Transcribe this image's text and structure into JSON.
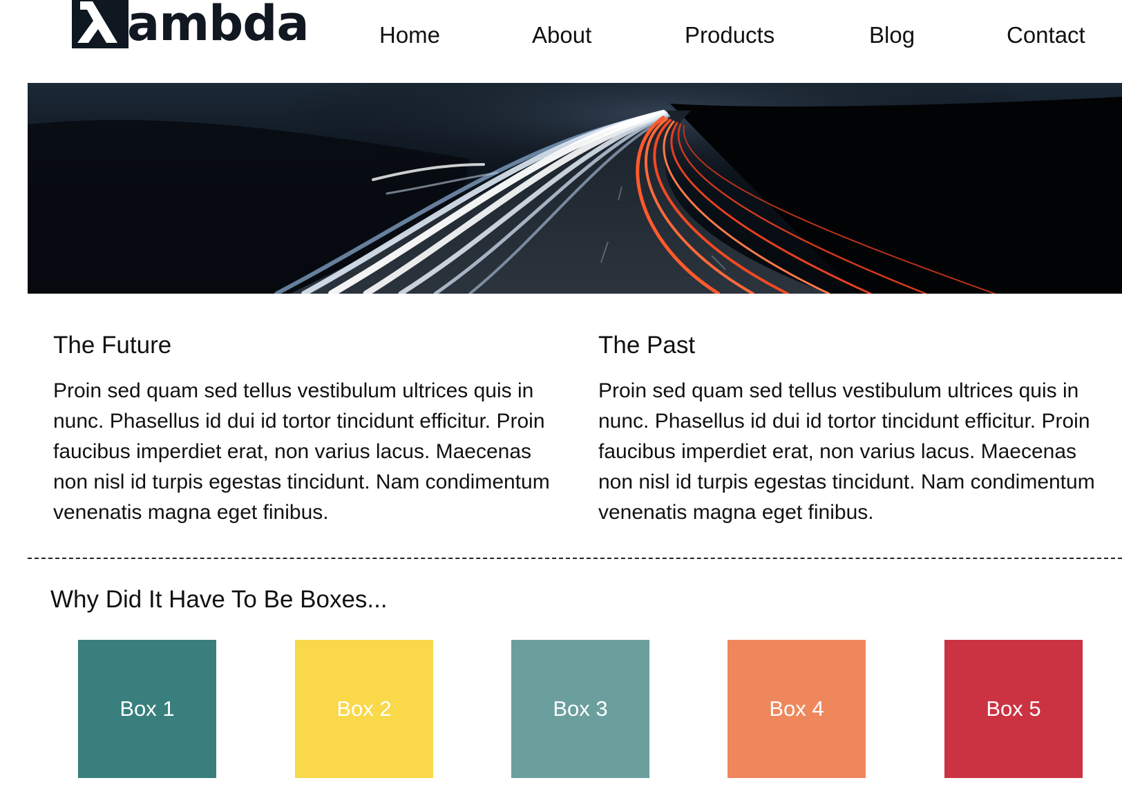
{
  "brand": {
    "logo_text": "ambda",
    "logo_symbol": "λ"
  },
  "nav": {
    "items": [
      "Home",
      "About",
      "Products",
      "Blog",
      "Contact"
    ]
  },
  "hero": {
    "image_name": "highway-light-trails-at-night"
  },
  "columns": [
    {
      "title": "The Future",
      "body": "Proin sed quam sed tellus vestibulum ultrices quis in nunc. Phasellus id dui id tortor tincidunt efficitur. Proin faucibus imperdiet erat, non varius lacus. Maecenas non nisl id turpis egestas tincidunt. Nam condimentum venenatis magna eget finibus."
    },
    {
      "title": "The Past",
      "body": "Proin sed quam sed tellus vestibulum ultrices quis in nunc. Phasellus id dui id tortor tincidunt efficitur. Proin faucibus imperdiet erat, non varius lacus. Maecenas non nisl id turpis egestas tincidunt. Nam condimentum venenatis magna eget finibus."
    }
  ],
  "boxes_section": {
    "title": "Why Did It Have To Be Boxes..."
  },
  "boxes": [
    {
      "label": "Box 1",
      "color": "#387f7e"
    },
    {
      "label": "Box 2",
      "color": "#f9d84a"
    },
    {
      "label": "Box 3",
      "color": "#6b9f9e"
    },
    {
      "label": "Box 4",
      "color": "#ef875c"
    },
    {
      "label": "Box 5",
      "color": "#cb3343"
    }
  ]
}
